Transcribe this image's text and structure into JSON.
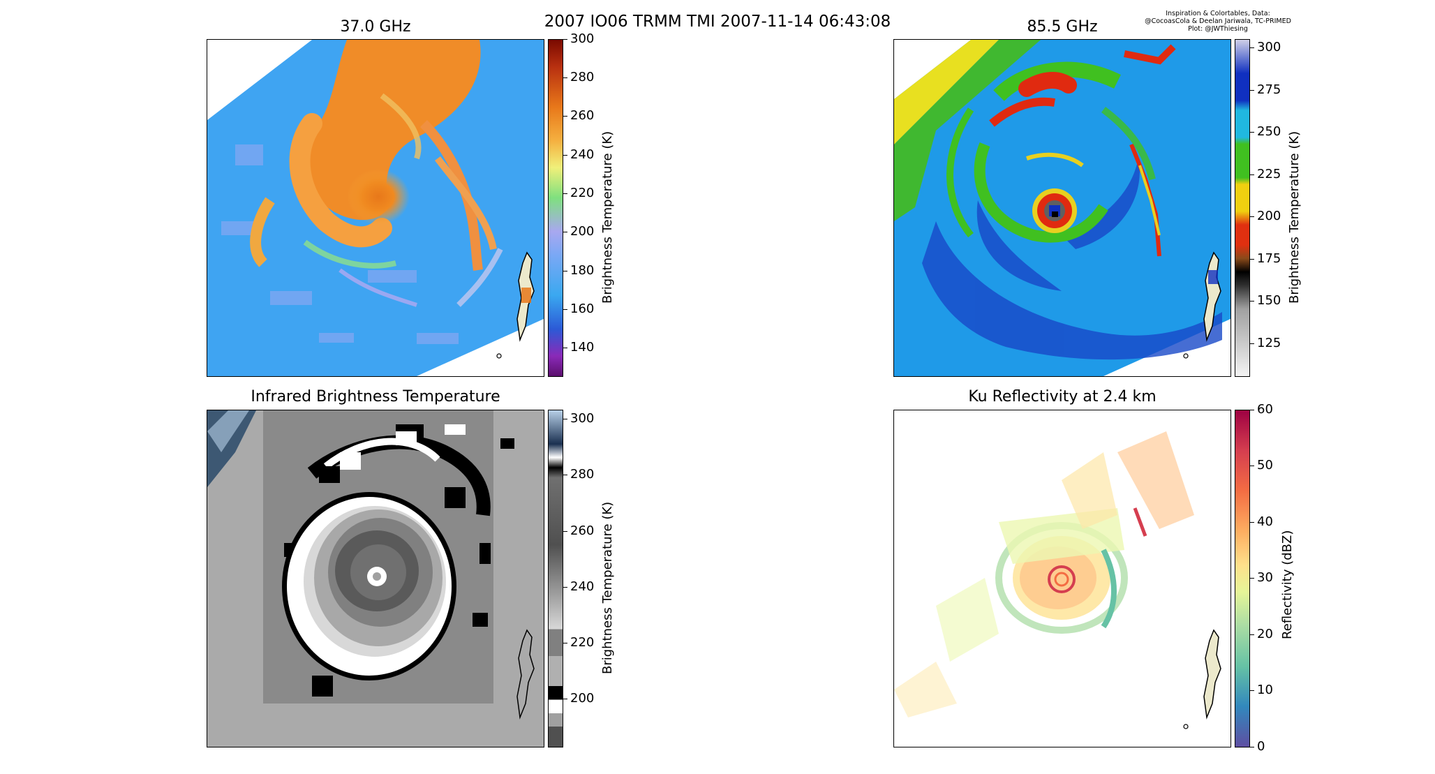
{
  "suptitle": "2007 IO06 TRMM TMI 2007-11-14 06:43:08",
  "credit": {
    "line1": "Inspiration & Colortables, Data:",
    "line2": "@CocoasCola & Deelan Jariwala, TC-PRIMED",
    "line3": "Plot: @JWThiesing"
  },
  "colors": {
    "frame": "#000000",
    "land": "#ece9cc",
    "background": "#ffffff"
  },
  "chart_data": [
    {
      "type": "heatmap",
      "title": "37.0 GHz",
      "colorbar_label": "Brightness Temperature (K)",
      "ticks": [
        "300",
        "280",
        "260",
        "240",
        "220",
        "200",
        "180",
        "160",
        "140"
      ],
      "vmin": 125,
      "vmax": 300,
      "colormap": [
        "#5c0f6e",
        "#8a2ab8",
        "#2c5ad6",
        "#3aa8f0",
        "#7aa8f5",
        "#a8a8f0",
        "#7fe07f",
        "#f0f07a",
        "#f5b040",
        "#e8781a",
        "#b83010",
        "#7a0a00"
      ]
    },
    {
      "type": "heatmap",
      "title": "85.5 GHz",
      "colorbar_label": "Brightness Temperature (K)",
      "ticks": [
        "300",
        "275",
        "250",
        "225",
        "200",
        "175",
        "150",
        "125"
      ],
      "vmin": 105,
      "vmax": 305,
      "colormap": [
        "#f4f4f4",
        "#a0a0a0",
        "#303030",
        "#000000",
        "#8a4a1a",
        "#e03010",
        "#f0d010",
        "#40c020",
        "#20b8e0",
        "#1030c0",
        "#d0d0e8"
      ]
    },
    {
      "type": "heatmap",
      "title": "Infrared Brightness Temperature",
      "colorbar_label": "Brightness Temperature (K)",
      "ticks": [
        "300",
        "280",
        "260",
        "240",
        "220",
        "200"
      ],
      "vmin": 183,
      "vmax": 304,
      "colormap": [
        "#505050",
        "#a0a0a0",
        "#ffffff",
        "#000000",
        "#b0b0b0",
        "#808080",
        "#d8d8d8",
        "#505050",
        "#000000",
        "#ffffff",
        "#1a3050",
        "#b8d0e8"
      ]
    },
    {
      "type": "heatmap",
      "title": "Ku Reflectivity at 2.4 km",
      "colorbar_label": "Reflectivity (dBZ)",
      "ticks": [
        "60",
        "50",
        "40",
        "30",
        "20",
        "10",
        "0"
      ],
      "vmin": 0,
      "vmax": 60,
      "colormap": [
        "#5e4fa2",
        "#3288bd",
        "#66c2a5",
        "#abdda4",
        "#e6f598",
        "#fee08b",
        "#fdae61",
        "#f46d43",
        "#d53e4f",
        "#9e0142"
      ]
    }
  ]
}
